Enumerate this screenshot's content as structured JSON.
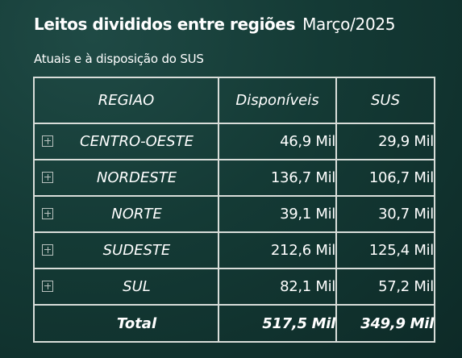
{
  "header": {
    "title": "Leitos divididos entre regiões",
    "period": "Março/2025",
    "subtitle": "Atuais e à disposição do SUS"
  },
  "table": {
    "columns": [
      "REGIAO",
      "Disponíveis",
      "SUS"
    ],
    "rows": [
      {
        "region": "CENTRO-OESTE",
        "disponiveis": "46,9 Mil",
        "sus": "29,9 Mil"
      },
      {
        "region": "NORDESTE",
        "disponiveis": "136,7 Mil",
        "sus": "106,7 Mil"
      },
      {
        "region": "NORTE",
        "disponiveis": "39,1 Mil",
        "sus": "30,7 Mil"
      },
      {
        "region": "SUDESTE",
        "disponiveis": "212,6 Mil",
        "sus": "125,4 Mil"
      },
      {
        "region": "SUL",
        "disponiveis": "82,1 Mil",
        "sus": "57,2 Mil"
      }
    ],
    "total": {
      "label": "Total",
      "disponiveis": "517,5 Mil",
      "sus": "349,9 Mil"
    }
  },
  "icons": {
    "expand": "expand-plus-icon"
  },
  "colors": {
    "background": "#143a35",
    "border": "#d8ddd9",
    "text": "#ffffff"
  }
}
